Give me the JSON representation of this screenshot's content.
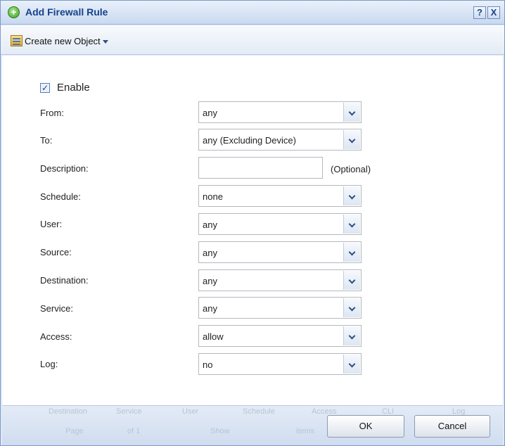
{
  "dialog": {
    "title": "Add Firewall Rule",
    "help_glyph": "?",
    "close_glyph": "X"
  },
  "toolbar": {
    "create_object_label": "Create new Object"
  },
  "form": {
    "enable": {
      "label": "Enable",
      "checked": true,
      "check_glyph": "✓"
    },
    "fields": {
      "from": {
        "label": "From:",
        "value": "any"
      },
      "to": {
        "label": "To:",
        "value": "any (Excluding Device)"
      },
      "description": {
        "label": "Description:",
        "value": "",
        "note": "(Optional)"
      },
      "schedule": {
        "label": "Schedule:",
        "value": "none"
      },
      "user": {
        "label": "User:",
        "value": "any"
      },
      "source": {
        "label": "Source:",
        "value": "any"
      },
      "destination": {
        "label": "Destination:",
        "value": "any"
      },
      "service": {
        "label": "Service:",
        "value": "any"
      },
      "access": {
        "label": "Access:",
        "value": "allow"
      },
      "log": {
        "label": "Log:",
        "value": "no"
      }
    }
  },
  "footer": {
    "ok_label": "OK",
    "cancel_label": "Cancel",
    "background_ghost": {
      "columns": [
        "Destination",
        "Service",
        "User",
        "Schedule",
        "Access",
        "CLI",
        "Log"
      ],
      "pager": [
        "Page",
        "of 1",
        "Show",
        "items"
      ]
    }
  },
  "colors": {
    "title_text": "#15428b",
    "frame_border": "#7b9bc8",
    "footer_bg": "#d9e4f3"
  },
  "icons": {
    "title": "add-circle-icon",
    "create_object": "object-list-icon",
    "dropdown": "chevron-down-icon"
  }
}
